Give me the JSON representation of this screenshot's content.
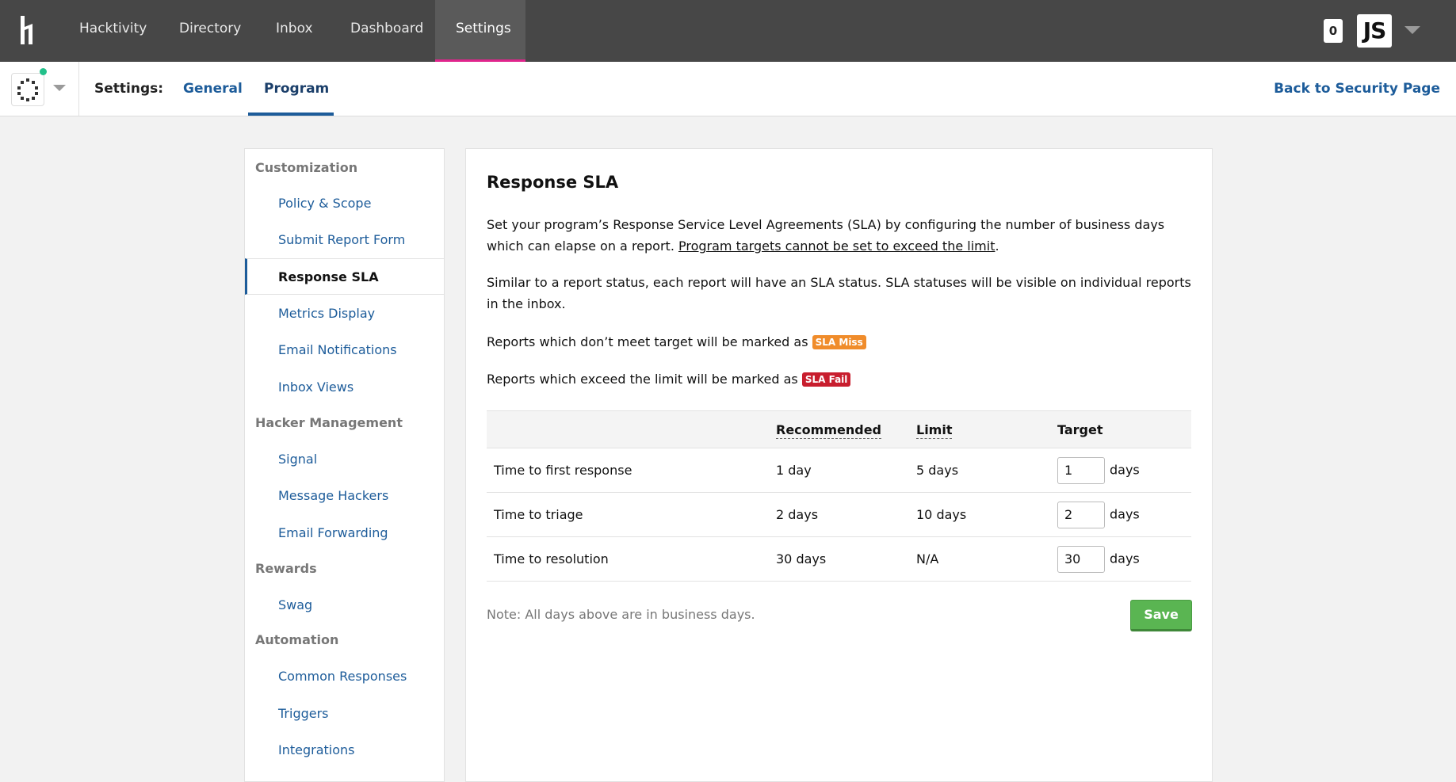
{
  "topnav": {
    "items": [
      "Hacktivity",
      "Directory",
      "Inbox",
      "Dashboard",
      "Settings"
    ],
    "active": "Settings",
    "notification_count": "0",
    "avatar_initials": "JS"
  },
  "subnav": {
    "label": "Settings:",
    "tabs": [
      "General",
      "Program"
    ],
    "active_tab": "Program",
    "back_link": "Back to Security Page"
  },
  "sidebar": {
    "sections": [
      {
        "title": "Customization",
        "items": [
          "Policy & Scope",
          "Submit Report Form",
          "Response SLA",
          "Metrics Display",
          "Email Notifications",
          "Inbox Views"
        ]
      },
      {
        "title": "Hacker Management",
        "items": [
          "Signal",
          "Message Hackers",
          "Email Forwarding"
        ]
      },
      {
        "title": "Rewards",
        "items": [
          "Swag"
        ]
      },
      {
        "title": "Automation",
        "items": [
          "Common Responses",
          "Triggers",
          "Integrations"
        ]
      }
    ],
    "active_item": "Response SLA"
  },
  "main": {
    "title": "Response SLA",
    "intro": "Set your program’s Response Service Level Agreements (SLA) by configuring the number of business days which can elapse on a report. ",
    "intro_link": "Program targets cannot be set to exceed the limit",
    "intro_end": ".",
    "para2": "Similar to a report status, each report will have an SLA status. SLA statuses will be visible on individual reports in the inbox.",
    "miss_text": "Reports which don’t meet target will be marked as ",
    "miss_badge": "SLA Miss",
    "fail_text": "Reports which exceed the limit will be marked as ",
    "fail_badge": "SLA Fail",
    "table": {
      "headers": [
        "",
        "Recommended",
        "Limit",
        "Target"
      ],
      "rows": [
        {
          "label": "Time to first response",
          "recommended": "1 day",
          "limit": "5 days",
          "target": "1",
          "unit": "days"
        },
        {
          "label": "Time to triage",
          "recommended": "2 days",
          "limit": "10 days",
          "target": "2",
          "unit": "days"
        },
        {
          "label": "Time to resolution",
          "recommended": "30 days",
          "limit": "N/A",
          "target": "30",
          "unit": "days"
        }
      ]
    },
    "note": "Note: All days above are in business days.",
    "save_label": "Save"
  },
  "colors": {
    "topbar": "#474747",
    "active_underline": "#e0248c",
    "link": "#1d5c9a",
    "sla_miss": "#f08c2b",
    "sla_fail": "#c81e2e",
    "save": "#5ab552"
  }
}
